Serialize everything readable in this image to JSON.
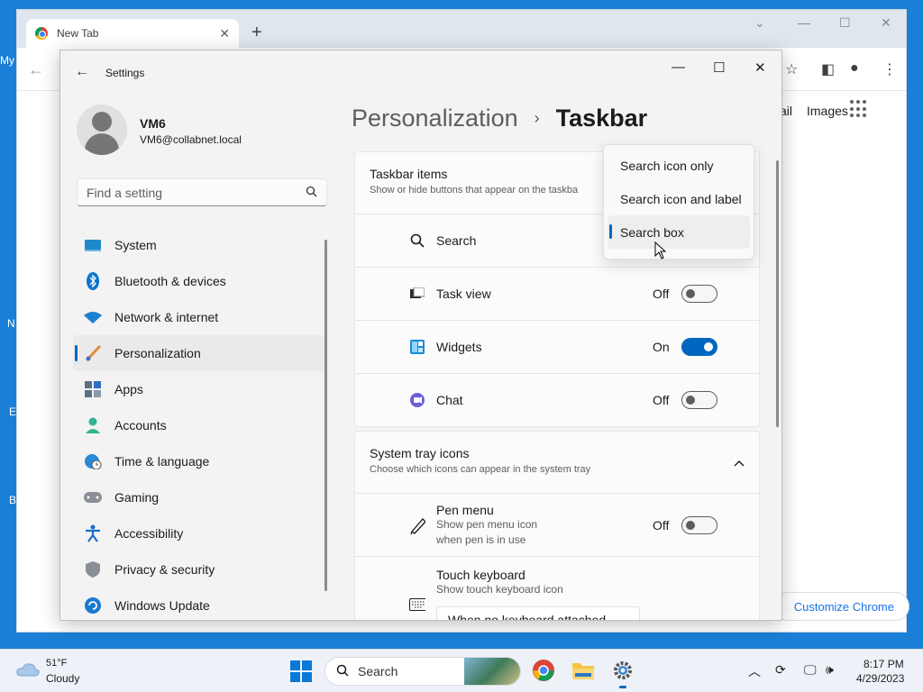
{
  "desktop": {
    "labels": [
      "My",
      "N",
      "E",
      "B"
    ]
  },
  "browser": {
    "tab_title": "New Tab",
    "new_tab": "+",
    "links": {
      "gmail_partial": "ail",
      "images": "Images"
    },
    "customize_label": "Customize Chrome"
  },
  "settings": {
    "window_title": "Settings",
    "profile": {
      "name": "VM6",
      "email": "VM6@collabnet.local"
    },
    "search_placeholder": "Find a setting",
    "nav": [
      {
        "label": "System",
        "icon": "system-icon",
        "active": false
      },
      {
        "label": "Bluetooth & devices",
        "icon": "bluetooth-icon",
        "active": false
      },
      {
        "label": "Network & internet",
        "icon": "wifi-icon",
        "active": false
      },
      {
        "label": "Personalization",
        "icon": "brush-icon",
        "active": true
      },
      {
        "label": "Apps",
        "icon": "apps-icon",
        "active": false
      },
      {
        "label": "Accounts",
        "icon": "accounts-icon",
        "active": false
      },
      {
        "label": "Time & language",
        "icon": "globe-clock-icon",
        "active": false
      },
      {
        "label": "Gaming",
        "icon": "gamepad-icon",
        "active": false
      },
      {
        "label": "Accessibility",
        "icon": "accessibility-icon",
        "active": false
      },
      {
        "label": "Privacy & security",
        "icon": "shield-icon",
        "active": false
      },
      {
        "label": "Windows Update",
        "icon": "update-icon",
        "active": false
      }
    ],
    "breadcrumb": {
      "parent": "Personalization",
      "separator": "›",
      "current": "Taskbar"
    },
    "taskbar_items": {
      "title": "Taskbar items",
      "description": "Show or hide buttons that appear on the taskba",
      "rows": [
        {
          "label": "Search",
          "icon": "search-icon"
        },
        {
          "label": "Task view",
          "icon": "task-view-icon",
          "state": "Off",
          "on": false
        },
        {
          "label": "Widgets",
          "icon": "widgets-icon",
          "state": "On",
          "on": true
        },
        {
          "label": "Chat",
          "icon": "chat-icon",
          "state": "Off",
          "on": false
        }
      ]
    },
    "search_flyout": {
      "options": [
        "Search icon only",
        "Search icon and label",
        "Search box"
      ],
      "selected": "Search box"
    },
    "system_tray": {
      "title": "System tray icons",
      "description": "Choose which icons can appear in the system tray",
      "pen_menu": {
        "label": "Pen menu",
        "sub1": "Show pen menu icon",
        "sub2": "when pen is in use",
        "state": "Off"
      },
      "touch_keyboard": {
        "label": "Touch keyboard",
        "sub": "Show touch keyboard icon",
        "select_value": "When no keyboard attached"
      }
    }
  },
  "taskbar": {
    "weather": {
      "temp": "51°F",
      "condition": "Cloudy"
    },
    "search_label": "Search",
    "clock": {
      "time": "8:17 PM",
      "date": "4/29/2023"
    }
  },
  "colors": {
    "accent": "#0067c0",
    "desktop": "#1a7fd6"
  }
}
